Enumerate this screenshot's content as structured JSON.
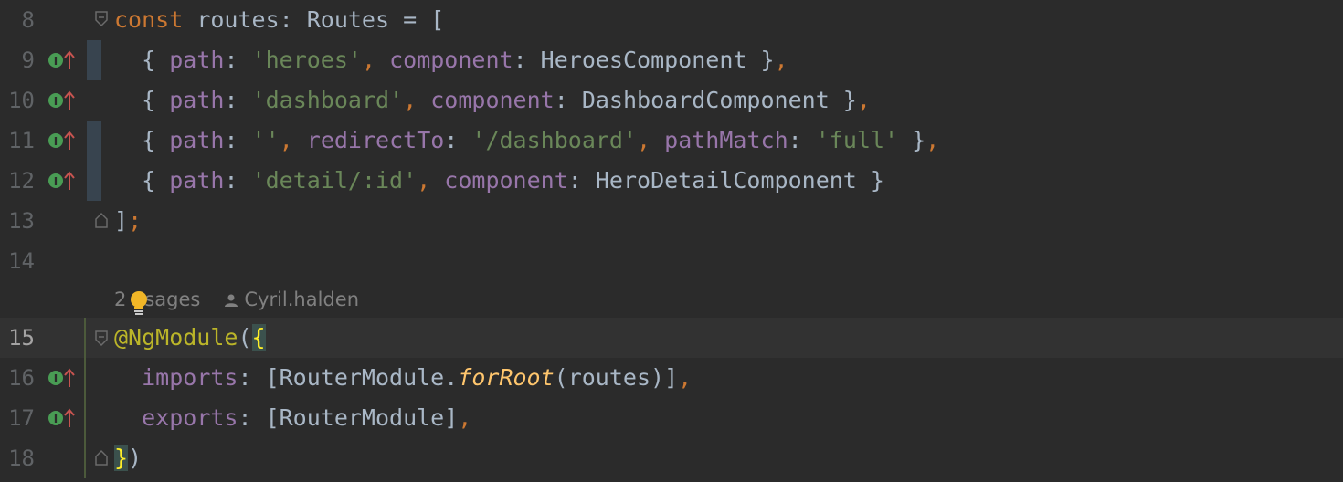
{
  "editor": {
    "lines": [
      {
        "num": "8"
      },
      {
        "num": "9"
      },
      {
        "num": "10"
      },
      {
        "num": "11"
      },
      {
        "num": "12"
      },
      {
        "num": "13"
      },
      {
        "num": "14"
      },
      {
        "num": "15"
      },
      {
        "num": "16"
      },
      {
        "num": "17"
      },
      {
        "num": "18"
      }
    ],
    "code": {
      "l8": {
        "kw": "const",
        "name": " routes: Routes = ["
      },
      "l9": {
        "p1": "  { ",
        "path": "path",
        "c1": ": ",
        "s1": "'heroes'",
        "comma": ",",
        "sp": " ",
        "prop2": "component",
        "c2": ": HeroesComponent }",
        "end": ","
      },
      "l10": {
        "p1": "  { ",
        "path": "path",
        "c1": ": ",
        "s1": "'dashboard'",
        "comma": ",",
        "sp": " ",
        "prop2": "component",
        "c2": ": DashboardComponent }",
        "end": ","
      },
      "l11": {
        "p1": "  { ",
        "path": "path",
        "c1": ": ",
        "s1": "''",
        "comma": ",",
        "sp": " ",
        "prop2": "redirectTo",
        "c2": ": ",
        "s2": "'/dashboard'",
        "comma2": ",",
        "sp2": " ",
        "prop3": "pathMatch",
        "c3": ": ",
        "s3": "'full'",
        "c4": " }",
        "end": ","
      },
      "l12": {
        "p1": "  { ",
        "path": "path",
        "c1": ": ",
        "s1": "'detail/:id'",
        "comma": ",",
        "sp": " ",
        "prop2": "component",
        "c2": ": HeroDetailComponent }"
      },
      "l13": {
        "bracket": "]",
        "semi": ";"
      },
      "l15": {
        "ann": "@NgModule",
        "paren": "(",
        "brace": "{"
      },
      "l16": {
        "p1": "  ",
        "prop": "imports",
        "c1": ": [RouterModule.",
        "fn": "forRoot",
        "c2": "(routes)]",
        "end": ","
      },
      "l17": {
        "p1": "  ",
        "prop": "exports",
        "c1": ": [RouterModule]",
        "end": ","
      },
      "l18": {
        "brace": "}",
        "paren": ")"
      }
    },
    "hint": {
      "usages": "2 usages",
      "author": "Cyril.halden"
    }
  },
  "colors": {
    "background": "#2b2b2b",
    "keyword": "#cc7832",
    "property": "#9876aa",
    "string": "#6a8759",
    "function": "#ffc66d",
    "annotation": "#bbb529",
    "implements_icon": "#499c54",
    "override_arrow": "#c75450"
  }
}
